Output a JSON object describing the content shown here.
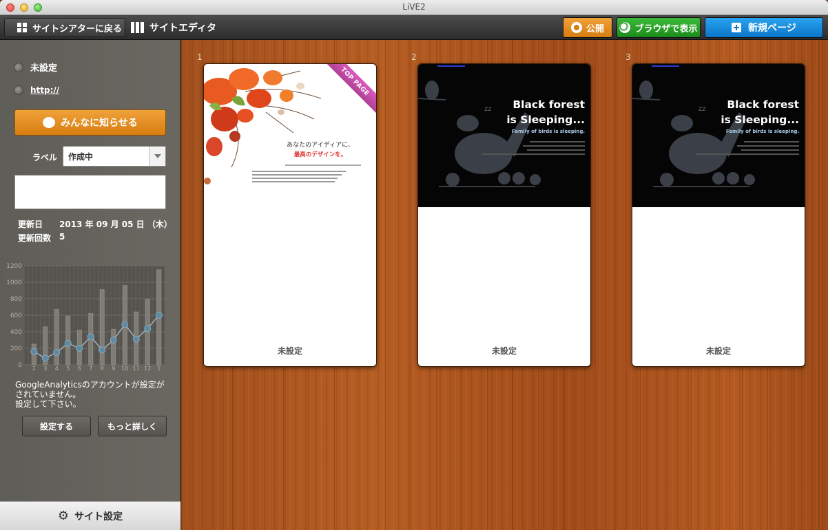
{
  "window": {
    "title": "LiVE2"
  },
  "toolbar": {
    "back_label": "サイトシアターに戻る",
    "editor_label": "サイトエディタ",
    "publish_label": "公開",
    "browser_label": "ブラウザで表示",
    "new_page_label": "新規ページ"
  },
  "sidebar": {
    "site_name": "未設定",
    "url": "http://",
    "share_label": "みんなに知らせる",
    "label_caption": "ラベル",
    "label_value": "作成中",
    "updated_caption": "更新日",
    "updated_value": "2013 年 09 月 05 日 （木）",
    "update_count_caption": "更新回数",
    "update_count_value": "5",
    "ga_note_line1": "GoogleAnalyticsのアカウントが設定が",
    "ga_note_line2": "されていません。",
    "ga_note_line3": "設定して下さい。",
    "setup_button": "設定する",
    "more_button": "もっと詳しく",
    "site_settings": "サイト設定"
  },
  "chart_data": {
    "type": "bar",
    "categories": [
      "2",
      "3",
      "4",
      "5",
      "6",
      "7",
      "8",
      "9",
      "10",
      "11",
      "12",
      "1"
    ],
    "series": [
      {
        "values": [
          250,
          460,
          670,
          590,
          420,
          620,
          910,
          430,
          960,
          640,
          790,
          1150
        ]
      },
      {
        "values": [
          160,
          80,
          150,
          260,
          200,
          340,
          180,
          300,
          490,
          310,
          440,
          600
        ]
      }
    ],
    "y_ticks": [
      "0",
      "200",
      "400",
      "600",
      "800",
      "1000",
      "1200"
    ],
    "ylim": [
      0,
      1200
    ],
    "grid": true
  },
  "pages": [
    {
      "number": "1",
      "label": "未設定",
      "badge": "TOP PAGE",
      "headline": "あなたのアイディアに、",
      "headline_accent": "最高のデザインを。",
      "colors": {
        "accent": "#e03a3a",
        "ribbon": "#c94aa9"
      }
    },
    {
      "number": "2",
      "label": "未設定",
      "title_line1": "Black forest",
      "title_line2": "is Sleeping...",
      "subtitle": "Family of birds is sleeping."
    },
    {
      "number": "3",
      "label": "未設定",
      "title_line1": "Black forest",
      "title_line2": "is Sleeping...",
      "subtitle": "Family of birds is sleeping."
    }
  ],
  "colors": {
    "publish": "#e08a1e",
    "browser": "#26a127",
    "new_page": "#1689dd",
    "sidebar_bg": "#64625c",
    "wood": "#ab551f"
  }
}
